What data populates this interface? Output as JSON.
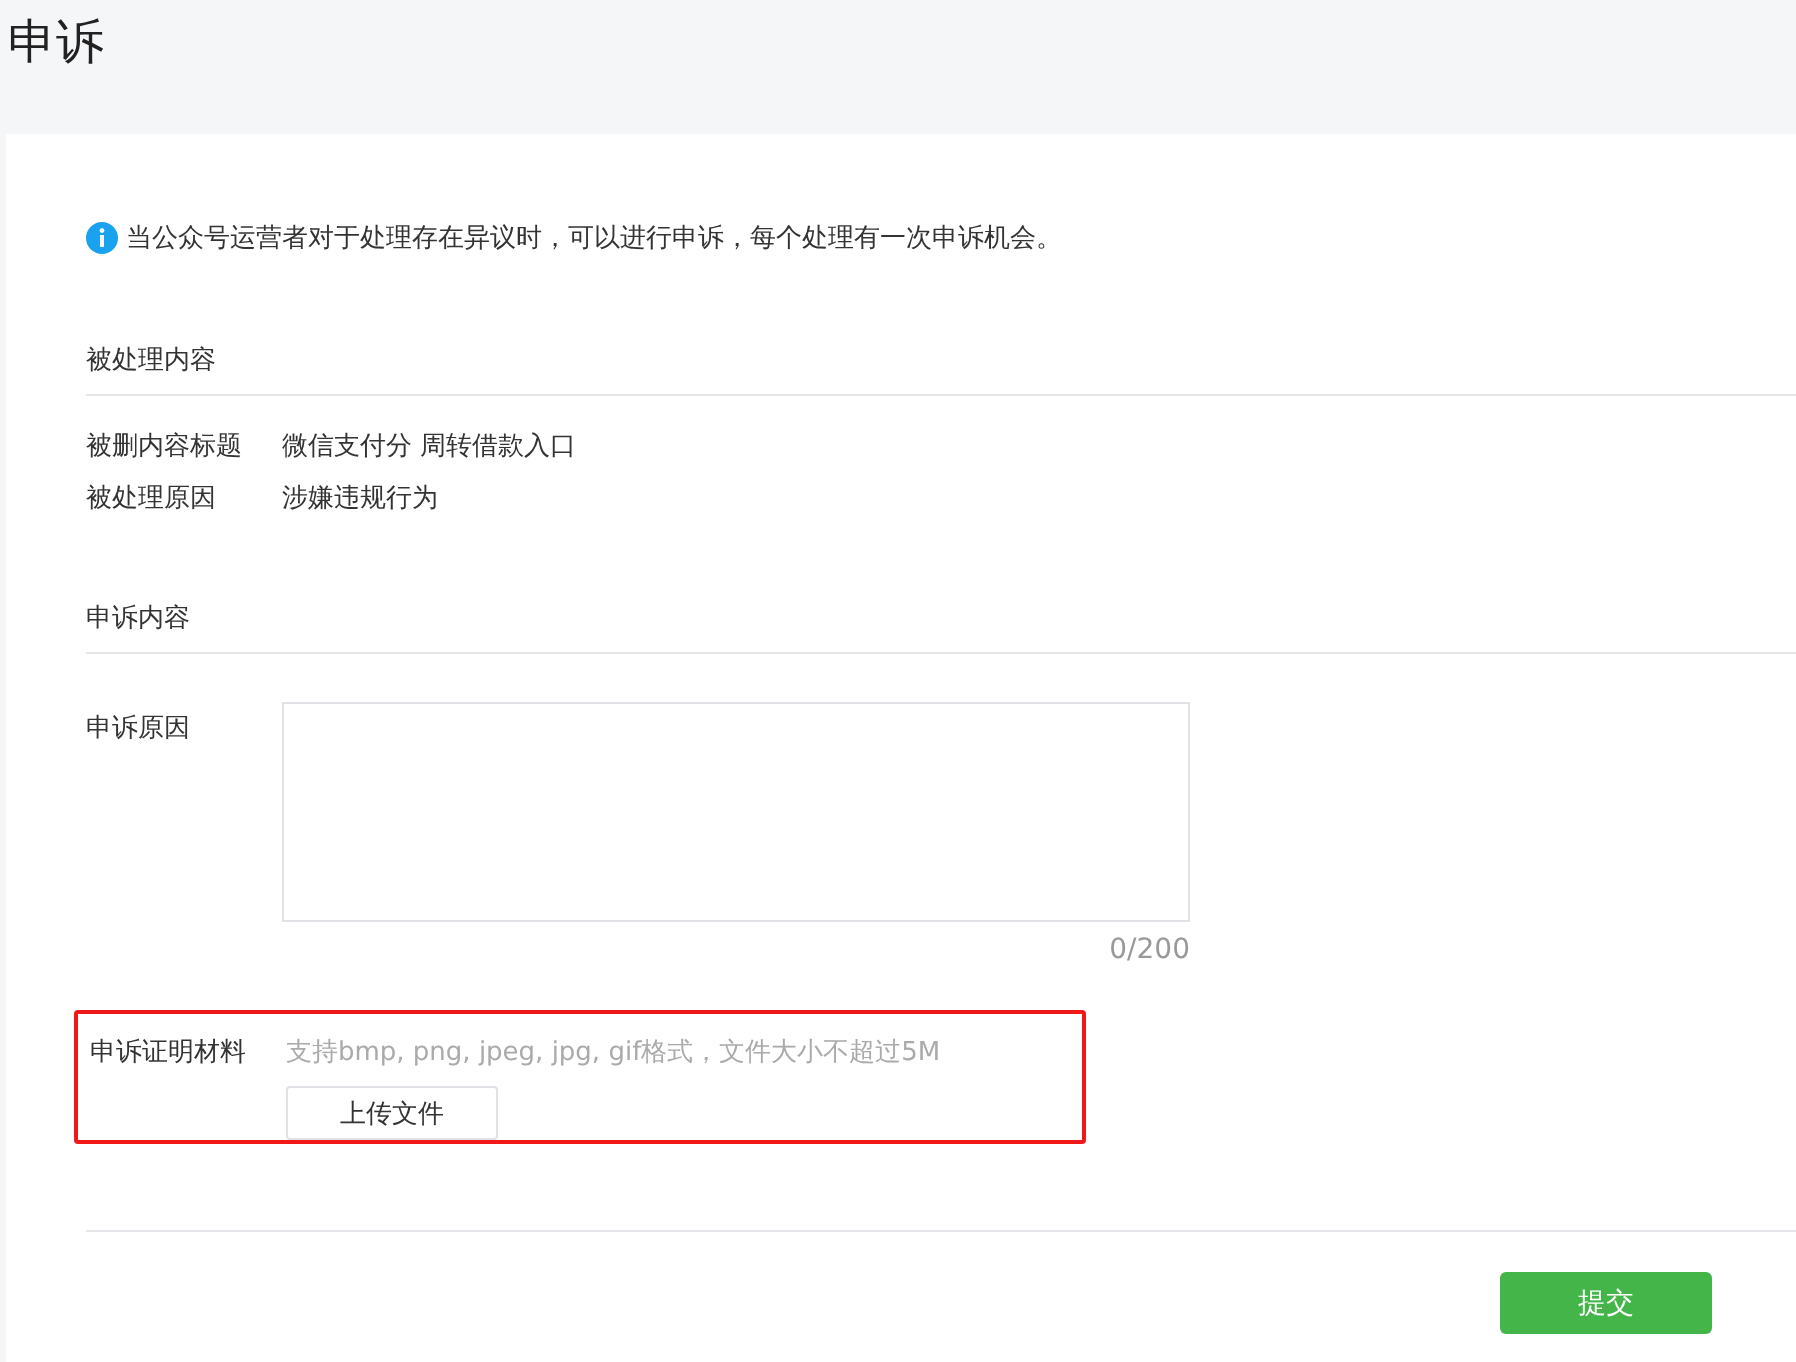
{
  "page_title": "申诉",
  "notice": "当公众号运营者对于处理存在异议时，可以进行申诉，每个处理有一次申诉机会。",
  "processed_section": {
    "heading": "被处理内容",
    "rows": [
      {
        "label": "被删内容标题",
        "value": "微信支付分 周转借款入口"
      },
      {
        "label": "被处理原因",
        "value": "涉嫌违规行为"
      }
    ]
  },
  "appeal_section": {
    "heading": "申诉内容",
    "reason": {
      "label": "申诉原因",
      "counter": "0/200"
    },
    "evidence": {
      "label": "申诉证明材料",
      "hint": "支持bmp, png, jpeg, jpg, gif格式，文件大小不超过5M",
      "button": "上传文件",
      "highlighted": true
    }
  },
  "submit": "提交"
}
